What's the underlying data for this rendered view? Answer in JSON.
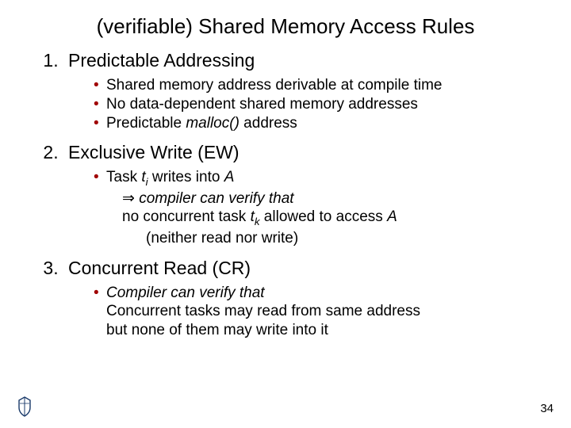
{
  "title": "(verifiable) Shared Memory Access Rules",
  "items": [
    {
      "label": "Predictable Addressing",
      "bullets": [
        {
          "plain": "Shared memory address derivable at compile time"
        },
        {
          "plain": "No data-dependent shared memory addresses"
        },
        {
          "pre": "Predictable ",
          "ital": "malloc()",
          "post": " address"
        }
      ]
    },
    {
      "label": "Exclusive Write (EW)",
      "bullets": [
        {
          "task_pre": "Task ",
          "task_var": "t",
          "task_sub": "i",
          "task_mid": " writes into ",
          "task_A": "A",
          "line2_arrow": "⇒ ",
          "line2_ital": "compiler can verify that",
          "line3_pre": "no concurrent task ",
          "line3_var": "t",
          "line3_sub": "k",
          "line3_mid": " allowed to access ",
          "line3_A": "A",
          "line4": "(neither read nor write)"
        }
      ]
    },
    {
      "label": "Concurrent Read (CR)",
      "bullets": [
        {
          "l1_ital": "Compiler can verify that",
          "l2": "Concurrent tasks may read from same address",
          "l3": "but none of them may write into it"
        }
      ]
    }
  ],
  "page": "34"
}
